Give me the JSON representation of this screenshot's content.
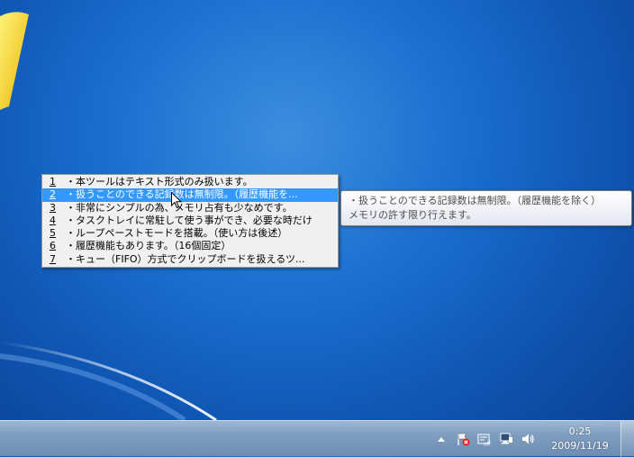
{
  "menu": {
    "items": [
      {
        "num": "1",
        "text": "・本ツールはテキスト形式のみ扱います。"
      },
      {
        "num": "2",
        "text": "・扱うことのできる記録数は無制限。（履歴機能を..."
      },
      {
        "num": "3",
        "text": "・非常にシンプルの為、メモリ占有も少なめです。"
      },
      {
        "num": "4",
        "text": "・タスクトレイに常駐して使う事ができ、必要な時だけ"
      },
      {
        "num": "5",
        "text": "・ループペーストモードを搭載。（使い方は後述）"
      },
      {
        "num": "6",
        "text": "・履歴機能もあります。（16個固定）"
      },
      {
        "num": "7",
        "text": "・キュー（FIFO）方式でクリップボードを扱えるツ..."
      }
    ],
    "selected_index": 1
  },
  "tooltip": {
    "line1": "・扱うことのできる記録数は無制限。（履歴機能を除く）",
    "line2": "メモリの許す限り行えます。"
  },
  "taskbar": {
    "clock_time": "0:25",
    "clock_date": "2009/11/19",
    "tray_icons": [
      "show-hidden-icon",
      "action-center-icon",
      "ime-off-icon",
      "network-icon",
      "volume-icon"
    ]
  },
  "colors": {
    "selection": "#3399ff",
    "menu_bg": "#f0f0f0"
  }
}
